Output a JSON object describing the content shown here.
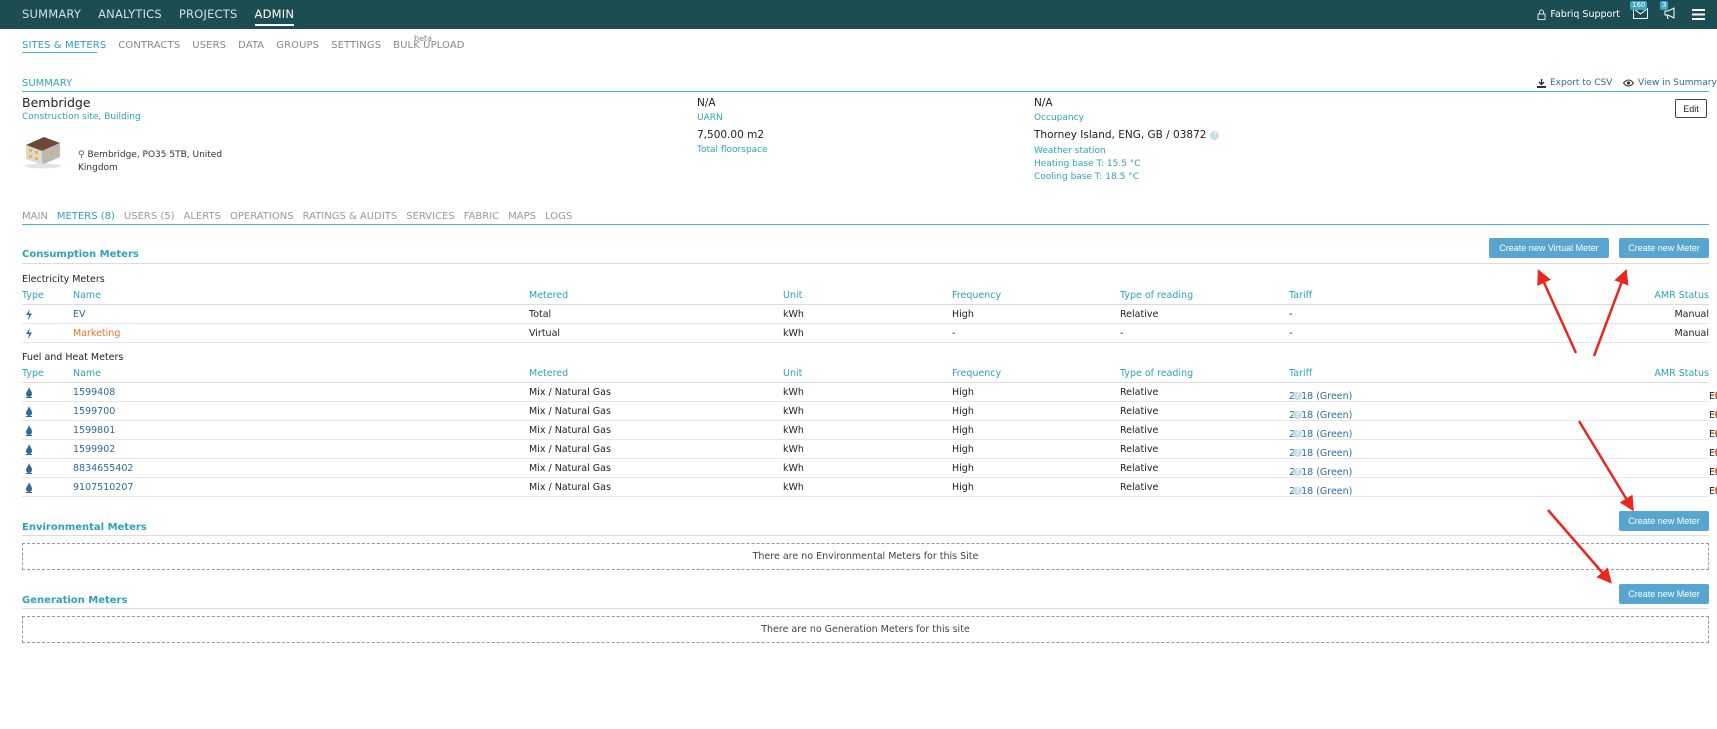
{
  "topnav": {
    "items": [
      "SUMMARY",
      "ANALYTICS",
      "PROJECTS",
      "ADMIN"
    ],
    "user": "Fabriq Support",
    "mail_count": "160",
    "notif_count": "3"
  },
  "subnav": {
    "items": [
      "SITES & METERS",
      "CONTRACTS",
      "USERS",
      "DATA",
      "GROUPS",
      "SETTINGS",
      "BULK UPLOAD"
    ],
    "beta": "beta"
  },
  "summary": {
    "heading": "SUMMARY",
    "export_label": "Export to CSV",
    "view_label": "View in Summary",
    "edit_label": "Edit",
    "site_name": "Bembridge",
    "site_type": "Construction site, Building",
    "address": "Bembridge, PO35 5TB, United Kingdom",
    "uarn_value": "N/A",
    "uarn_label": "UARN",
    "floor_value": "7,500.00 m2",
    "floor_label": "Total floorspace",
    "occupancy_value": "N/A",
    "occupancy_label": "Occupancy",
    "weather_value": "Thorney Island, ENG, GB / 03872",
    "weather_label": "Weather station",
    "heating_base": "Heating base T: 15.5 °C",
    "cooling_base": "Cooling base T: 18.5 °C"
  },
  "tabs": [
    "MAIN",
    "METERS (8)",
    "USERS (5)",
    "ALERTS",
    "OPERATIONS",
    "RATINGS & AUDITS",
    "SERVICES",
    "FABRIC",
    "MAPS",
    "LOGS"
  ],
  "consumption": {
    "title": "Consumption Meters",
    "btn_virtual": "Create new Virtual Meter",
    "btn_meter": "Create new Meter",
    "columns": [
      "Type",
      "Name",
      "Metered",
      "Unit",
      "Frequency",
      "Type of reading",
      "Tariff",
      "AMR Status"
    ],
    "electricity_title": "Electricity Meters",
    "electricity_rows": [
      {
        "name": "EV",
        "metered": "Total",
        "unit": "kWh",
        "freq": "High",
        "reading": "Relative",
        "tariff": "-",
        "amr": "Manual"
      },
      {
        "name": "Marketing",
        "metered": "Virtual",
        "unit": "kWh",
        "freq": "-",
        "reading": "-",
        "tariff": "-",
        "amr": "Manual"
      }
    ],
    "fuel_title": "Fuel and Heat Meters",
    "fuel_rows": [
      {
        "name": "1599408",
        "metered": "Mix / Natural Gas",
        "unit": "kWh",
        "freq": "High",
        "reading": "Relative",
        "tariff": "2018 (Green)",
        "amr": "Error"
      },
      {
        "name": "1599700",
        "metered": "Mix / Natural Gas",
        "unit": "kWh",
        "freq": "High",
        "reading": "Relative",
        "tariff": "2018 (Green)",
        "amr": "Error"
      },
      {
        "name": "1599801",
        "metered": "Mix / Natural Gas",
        "unit": "kWh",
        "freq": "High",
        "reading": "Relative",
        "tariff": "2018 (Green)",
        "amr": "Error"
      },
      {
        "name": "1599902",
        "metered": "Mix / Natural Gas",
        "unit": "kWh",
        "freq": "High",
        "reading": "Relative",
        "tariff": "2018 (Green)",
        "amr": "Error"
      },
      {
        "name": "8834655402",
        "metered": "Mix / Natural Gas",
        "unit": "kWh",
        "freq": "High",
        "reading": "Relative",
        "tariff": "2018 (Green)",
        "amr": "Error"
      },
      {
        "name": "9107510207",
        "metered": "Mix / Natural Gas",
        "unit": "kWh",
        "freq": "High",
        "reading": "Relative",
        "tariff": "2018 (Green)",
        "amr": "Error"
      }
    ]
  },
  "environmental": {
    "title": "Environmental Meters",
    "btn": "Create new Meter",
    "empty": "There are no Environmental Meters for this Site"
  },
  "generation": {
    "title": "Generation Meters",
    "btn": "Create new Meter",
    "empty": "There are no Generation Meters for this site"
  },
  "colors": {
    "topbar": "#1b4d52",
    "accent": "#2fa2b8",
    "button": "#58a5cf",
    "error": "#e85a2a",
    "arrow": "#e8281e"
  }
}
